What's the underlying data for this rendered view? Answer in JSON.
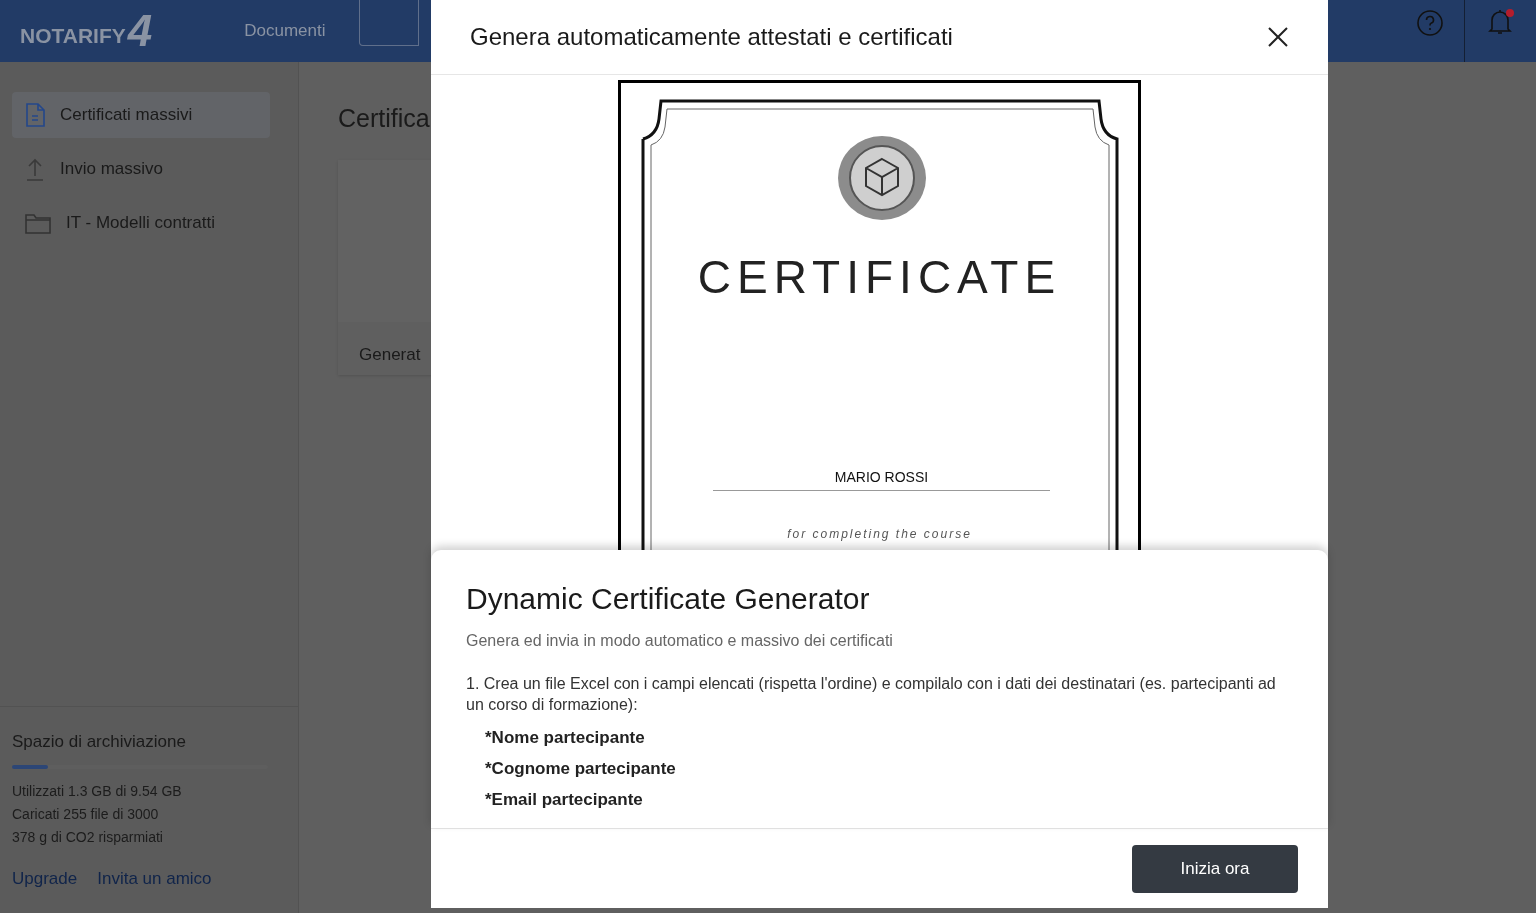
{
  "header": {
    "logo": "NOTARIFY",
    "logo_mark": "4",
    "nav": [
      {
        "label": "Documenti"
      }
    ],
    "notification_dot": true
  },
  "sidebar": {
    "items": [
      {
        "label": "Certificati massivi",
        "kind": "document",
        "selected": true
      },
      {
        "label": "Invio massivo",
        "kind": "upload",
        "selected": false
      },
      {
        "label": "IT - Modelli contratti",
        "kind": "folder",
        "selected": false
      }
    ],
    "storage": {
      "title": "Spazio di archiviazione",
      "level": 0.14,
      "lines": [
        "Utilizzati 1.3 GB di 9.54 GB",
        "Caricati 255 file di 3000",
        "378 g di CO2 risparmiati"
      ],
      "links": [
        "Upgrade",
        "Invita un amico"
      ]
    }
  },
  "main": {
    "title": "Certifica",
    "card_label": "Generat"
  },
  "modal": {
    "title": "Genera automaticamente attestati e certificati",
    "certificate": {
      "heading": "CERTIFICATE",
      "name": "MARIO ROSSI",
      "subtitle": "for completing the course"
    },
    "heading": "Dynamic Certificate Generator",
    "subtitle": "Genera ed invia in modo automatico e massivo dei certificati",
    "instruction": "1. Crea un file Excel con i campi elencati (rispetta l'ordine) e compilalo con i dati dei destinatari (es. partecipanti ad un corso di formazione):",
    "fields": [
      "*Nome partecipante",
      "*Cognome partecipante",
      "*Email partecipante"
    ],
    "button": "Inizia ora"
  }
}
